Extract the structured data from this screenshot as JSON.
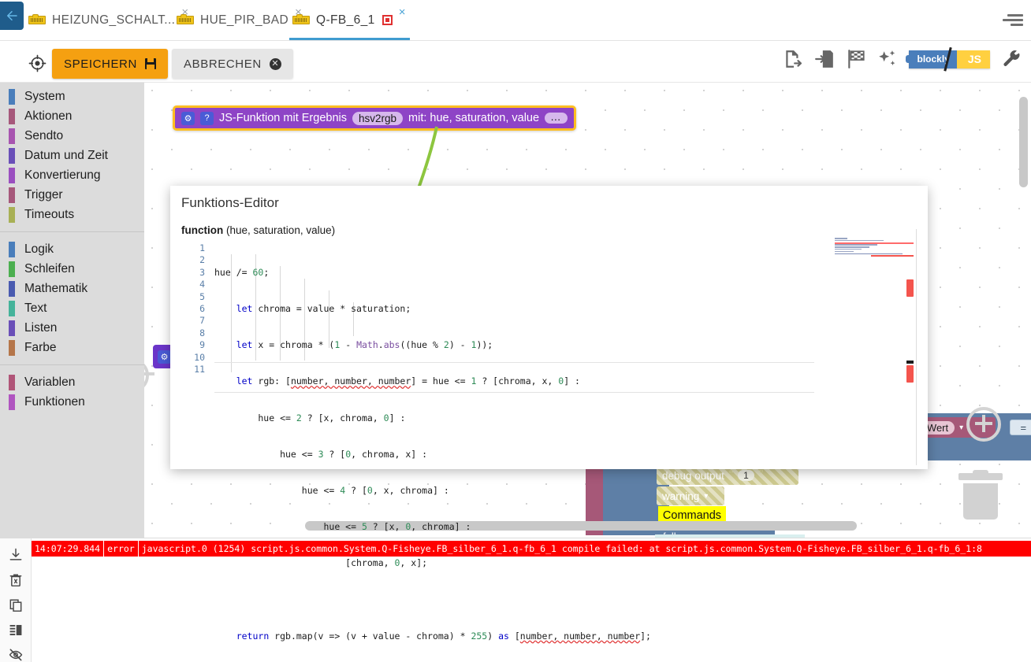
{
  "window": {
    "back_button": "back-arrow",
    "menu_icon": "sort-lines-icon"
  },
  "tabs": [
    {
      "label": "HEIZUNG_SCHALT...",
      "icon": "blockly-icon",
      "close": "×",
      "active": false,
      "dirty": false
    },
    {
      "label": "HUE_PIR_BAD",
      "icon": "blockly-icon",
      "close": "×",
      "active": false,
      "dirty": false
    },
    {
      "label": "Q-FB_6_1",
      "icon": "blockly-icon",
      "close": "×",
      "active": true,
      "dirty": true
    }
  ],
  "toolbar": {
    "locate_icon": "crosshair-target-icon",
    "save_label": "SPEICHERN",
    "save_icon": "floppy-disk-icon",
    "cancel_label": "ABBRECHEN",
    "cancel_icon": "close-circle-icon",
    "right_icons": [
      "export-file-icon",
      "import-file-icon",
      "checkered-flag-icon",
      "sparkles-icon"
    ],
    "toggle_left": "blockly",
    "toggle_right": "JS",
    "wrench_icon": "wrench-icon"
  },
  "categories": {
    "group1": [
      {
        "label": "System",
        "color": "#4a7ebb"
      },
      {
        "label": "Aktionen",
        "color": "#a6587b"
      },
      {
        "label": "Sendto",
        "color": "#a855b0"
      },
      {
        "label": "Datum und Zeit",
        "color": "#6a4fb8"
      },
      {
        "label": "Konvertierung",
        "color": "#9a4fc0"
      },
      {
        "label": "Trigger",
        "color": "#a6587b"
      },
      {
        "label": "Timeouts",
        "color": "#a8b055"
      }
    ],
    "group2": [
      {
        "label": "Logik",
        "color": "#4a7ebb"
      },
      {
        "label": "Schleifen",
        "color": "#4caf50"
      },
      {
        "label": "Mathematik",
        "color": "#4a5bb0"
      },
      {
        "label": "Text",
        "color": "#45b39a"
      },
      {
        "label": "Listen",
        "color": "#6a4fb8"
      },
      {
        "label": "Farbe",
        "color": "#b5764a"
      }
    ],
    "group3": [
      {
        "label": "Variablen",
        "color": "#b05578"
      },
      {
        "label": "Funktionen",
        "color": "#b055c0"
      }
    ]
  },
  "js_function_block": {
    "gear_icon": "gear-icon",
    "help_icon": "question-mark-icon",
    "text_before": "JS-Funktion mit Ergebnis",
    "name_field": "hsv2rgb",
    "text_middle": "mit: hue, saturation, value",
    "more_field": "…",
    "block_color": "#8e44c6",
    "selected_outline": "#ffbe20"
  },
  "ghost_blocks": {
    "debug_output": "debug output",
    "debug_quote_open": "“",
    "debug_quote_close": "”",
    "debug_value": "1",
    "warning_dropdown": "warning",
    "commands_tooltip": "Commands",
    "falls_label": "falls",
    "wert_label": "Wert",
    "equals_label": "=",
    "dropdown_caret": "▾"
  },
  "function_editor": {
    "title": "Funktions-Editor",
    "signature_keyword": "function",
    "signature_params": "(hue, saturation, value)",
    "code_lines": [
      {
        "n": 1,
        "text": "hue /= 60;"
      },
      {
        "n": 2,
        "text": "let chroma = value * saturation;"
      },
      {
        "n": 3,
        "text": "let x = chroma * (1 - Math.abs((hue % 2) - 1));"
      },
      {
        "n": 4,
        "text": "let rgb: [number, number, number] = hue <= 1 ? [chroma, x, 0] :"
      },
      {
        "n": 5,
        "text": "hue <= 2 ? [x, chroma, 0] :"
      },
      {
        "n": 6,
        "text": "hue <= 3 ? [0, chroma, x] :"
      },
      {
        "n": 7,
        "text": "hue <= 4 ? [0, x, chroma] :"
      },
      {
        "n": 8,
        "text": "hue <= 5 ? [x, 0, chroma] :"
      },
      {
        "n": 9,
        "text": "[chroma, 0, x];"
      },
      {
        "n": 10,
        "text": ""
      },
      {
        "n": 11,
        "text": "return rgb.map(v => (v + value - chroma) * 255) as [number, number, number];"
      }
    ],
    "minimap_name": "code-minimap"
  },
  "log": {
    "tool_icons": [
      "download-icon",
      "delete-icon",
      "copy-icon",
      "layout-icon",
      "hide-eye-icon"
    ],
    "entry": {
      "time": "14:07:29.844",
      "severity": "error",
      "message": "javascript.0 (1254) script.js.common.System.Q-Fisheye.FB_silber_6_1.q-fb_6_1 compile failed: at script.js.common.System.Q-Fisheye.FB_silber_6_1.q-fb_6_1:8"
    },
    "colors": {
      "error_bg": "#ff0000",
      "error_fg": "#ffffff"
    }
  },
  "canvas": {
    "trash_icon": "trashcan-icon",
    "zoom_center_icon": "zoom-center-icon",
    "zoom_in_icon": "zoom-in-icon",
    "scrollbar_v": "canvas-vertical-scrollbar",
    "scrollbar_h": "canvas-horizontal-scrollbar"
  }
}
